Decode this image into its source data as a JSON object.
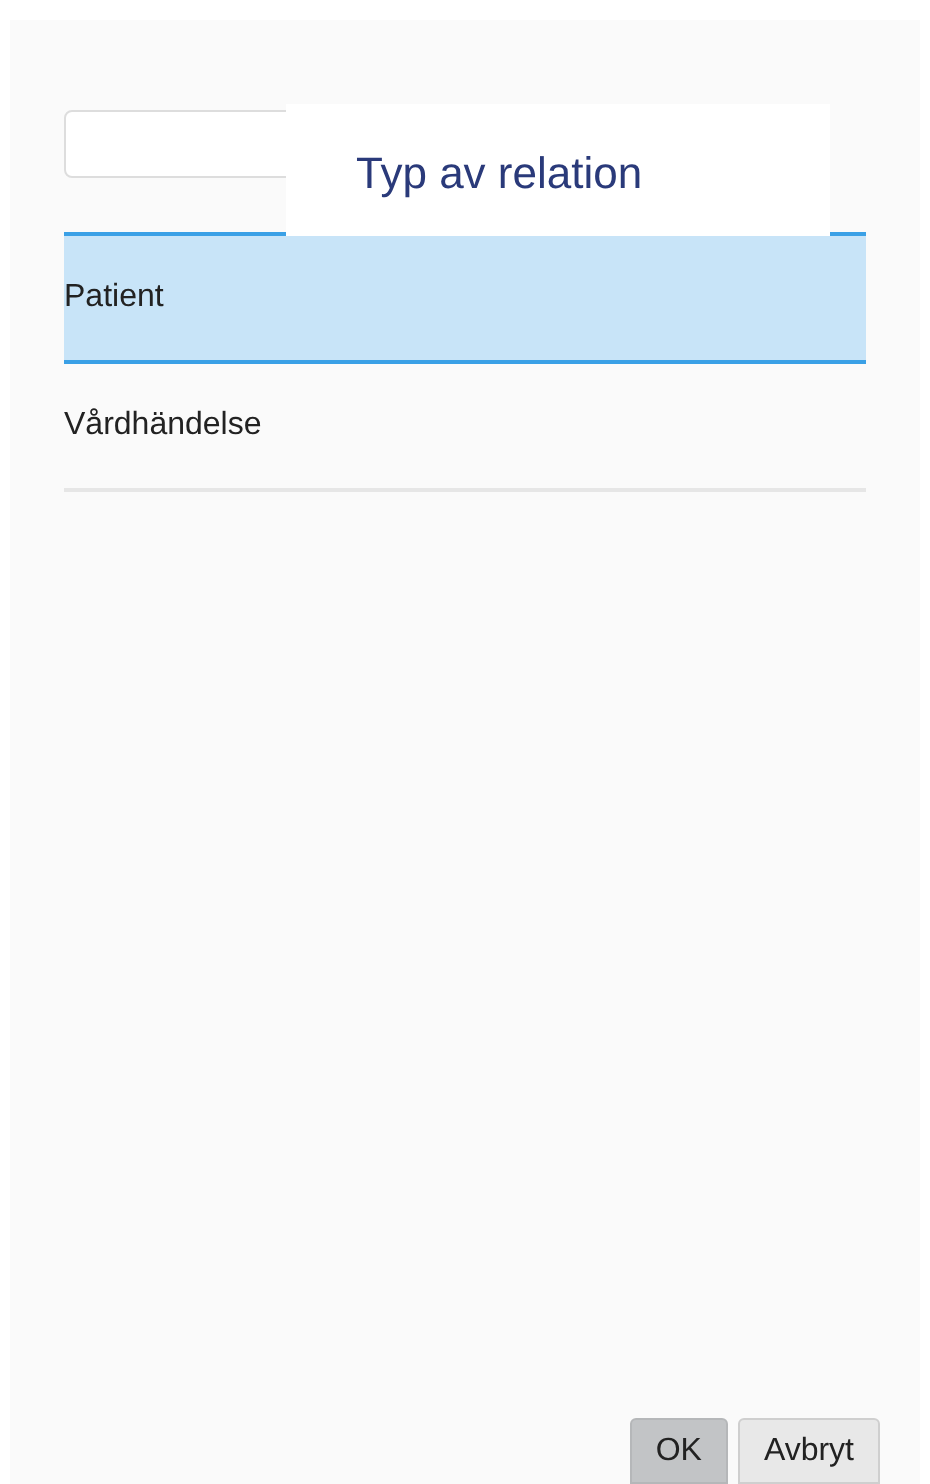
{
  "dialog": {
    "title": "Typ av relation"
  },
  "options": [
    {
      "label": "Patient",
      "selected": true
    },
    {
      "label": "Vårdhändelse",
      "selected": false
    }
  ],
  "buttons": [
    {
      "label": "OK",
      "kind": "primary"
    },
    {
      "label": "Avbryt",
      "kind": "secondary"
    }
  ]
}
